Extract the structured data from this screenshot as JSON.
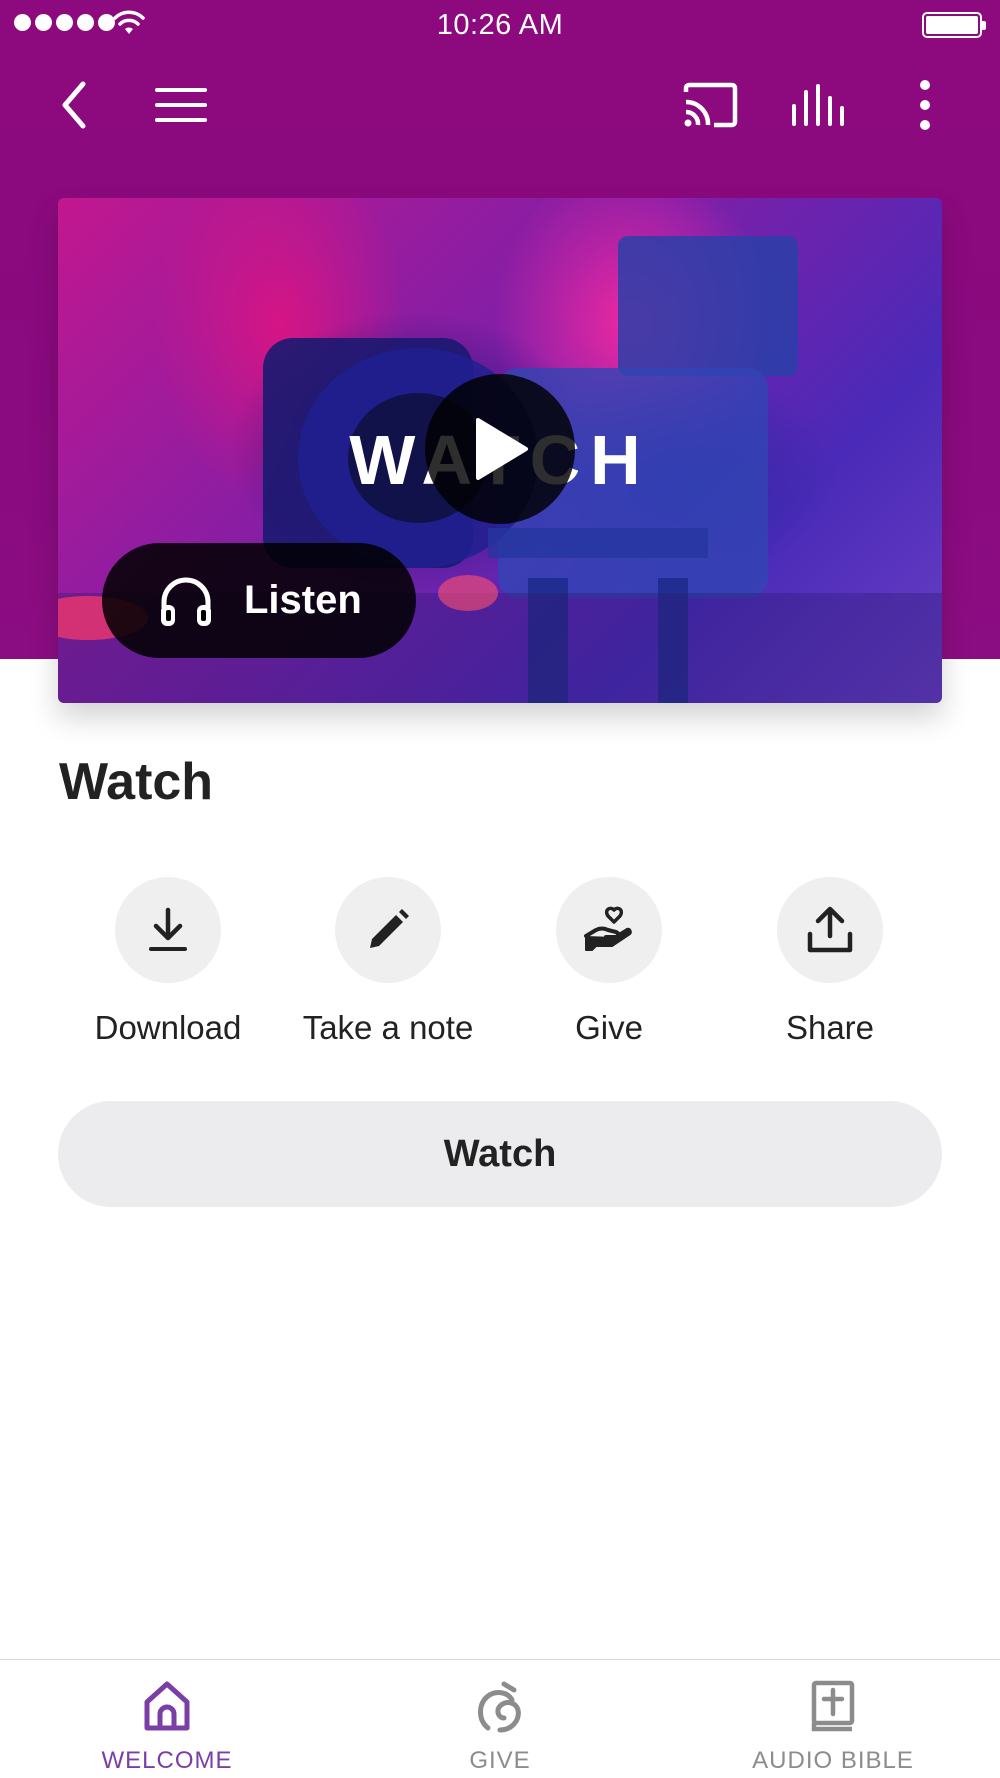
{
  "status_bar": {
    "time": "10:26 AM"
  },
  "toolbar": {
    "back_icon": "chevron-left-icon",
    "menu_icon": "hamburger-menu-icon",
    "cast_icon": "cast-icon",
    "equalizer_icon": "equalizer-icon",
    "more_icon": "more-vertical-icon"
  },
  "media": {
    "overlay_text": "WATCH",
    "play_icon": "play-icon",
    "listen_label": "Listen",
    "listen_icon": "headphones-icon"
  },
  "page": {
    "title": "Watch"
  },
  "actions": [
    {
      "label": "Download",
      "icon": "download-icon"
    },
    {
      "label": "Take a note",
      "icon": "pencil-icon"
    },
    {
      "label": "Give",
      "icon": "heart-hand-icon"
    },
    {
      "label": "Share",
      "icon": "share-icon"
    }
  ],
  "primary_button": {
    "label": "Watch"
  },
  "tabs": [
    {
      "label": "WELCOME",
      "icon": "home-icon",
      "active": true
    },
    {
      "label": "GIVE",
      "icon": "give-icon",
      "active": false
    },
    {
      "label": "AUDIO BIBLE",
      "icon": "bible-icon",
      "active": false
    }
  ],
  "colors": {
    "header_bg": "#8c0a7d",
    "active_tab": "#7a3ea6",
    "inactive_tab": "#8c8c8c",
    "button_bg": "#ececee"
  }
}
